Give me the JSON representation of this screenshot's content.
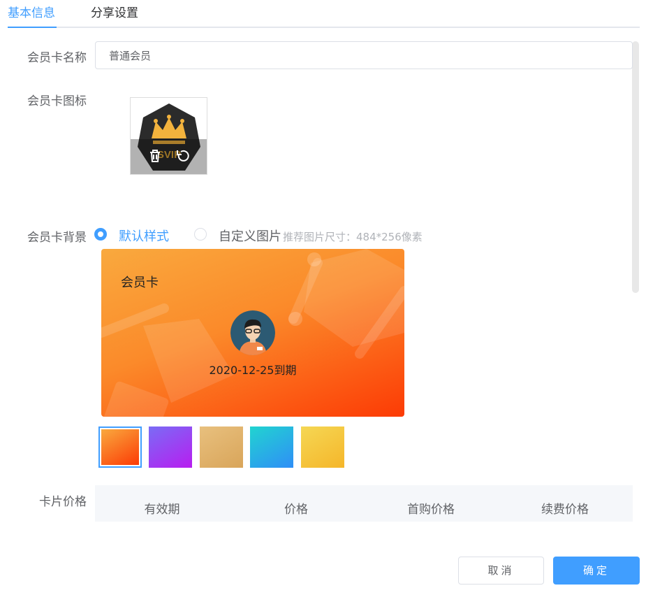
{
  "tabs": [
    {
      "label": "基本信息",
      "active": true
    },
    {
      "label": "分享设置",
      "active": false
    }
  ],
  "form": {
    "name_label": "会员卡名称",
    "name_value": "普通会员",
    "icon_label": "会员卡图标",
    "icon_badge": "SVIP",
    "background_label": "会员卡背景",
    "radio_default": "默认样式",
    "radio_custom": "自定义图片",
    "size_hint": "推荐图片尺寸：484*256像素",
    "price_label": "卡片价格"
  },
  "card_preview": {
    "title": "会员卡",
    "expiry": "2020-12-25到期"
  },
  "swatches": [
    {
      "name": "orange",
      "from": "#f9a93e",
      "to": "#fc3b05",
      "selected": true
    },
    {
      "name": "purple",
      "from": "#7a6cf5",
      "to": "#b81df0",
      "selected": false
    },
    {
      "name": "gold",
      "from": "#e8c07e",
      "to": "#d9a55a",
      "selected": false
    },
    {
      "name": "cyan",
      "from": "#21d4d0",
      "to": "#2f8ef7",
      "selected": false
    },
    {
      "name": "yellow",
      "from": "#f5d754",
      "to": "#f5b62a",
      "selected": false
    }
  ],
  "price_table": {
    "columns": [
      "有效期",
      "价格",
      "首购价格",
      "续费价格"
    ]
  },
  "buttons": {
    "cancel": "取消",
    "confirm": "确定"
  },
  "colors": {
    "primary": "#409eff",
    "text": "#606266"
  }
}
